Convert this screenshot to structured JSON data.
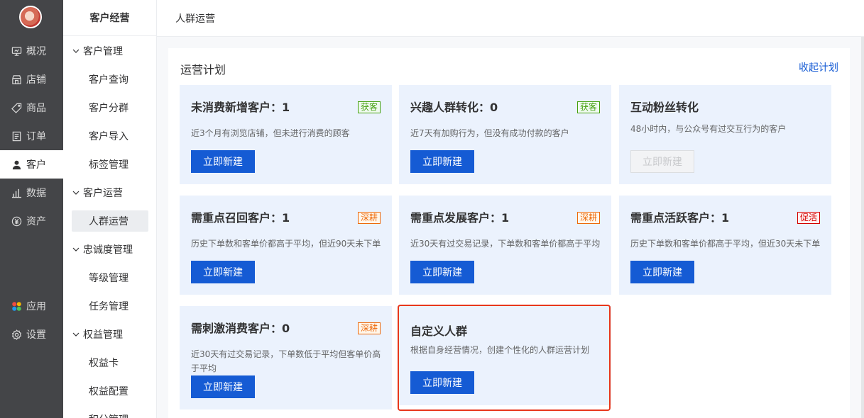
{
  "primary_nav": {
    "items": [
      {
        "label": "概况",
        "icon": "overview-icon"
      },
      {
        "label": "店铺",
        "icon": "store-icon"
      },
      {
        "label": "商品",
        "icon": "tag-icon"
      },
      {
        "label": "订单",
        "icon": "order-icon"
      },
      {
        "label": "客户",
        "icon": "user-icon",
        "active": true
      },
      {
        "label": "数据",
        "icon": "chart-icon"
      },
      {
        "label": "资产",
        "icon": "yen-icon"
      }
    ],
    "bottom_items": [
      {
        "label": "应用",
        "icon": "apps-icon"
      },
      {
        "label": "设置",
        "icon": "gear-icon"
      }
    ]
  },
  "secondary_nav": {
    "title": "客户经营",
    "groups": [
      {
        "label": "客户管理",
        "items": [
          "客户查询",
          "客户分群",
          "客户导入",
          "标签管理"
        ]
      },
      {
        "label": "客户运营",
        "items": [
          "人群运营"
        ]
      },
      {
        "label": "忠诚度管理",
        "items": [
          "等级管理",
          "任务管理"
        ]
      },
      {
        "label": "权益管理",
        "items": [
          "权益卡",
          "权益配置",
          "积分管理"
        ]
      }
    ],
    "active_item": "人群运营"
  },
  "header": {
    "breadcrumb": "人群运营"
  },
  "main": {
    "section_title": "运营计划",
    "collapse_label": "收起计划",
    "cards": [
      {
        "title": "未消费新增客户：1",
        "desc": "近3个月有浏览店铺，但未进行消费的顾客",
        "tag": "获客",
        "tag_color": "#45a110",
        "button": "立即新建"
      },
      {
        "title": "兴趣人群转化：0",
        "desc": "近7天有加购行为，但没有成功付款的客户",
        "tag": "获客",
        "tag_color": "#45a110",
        "button": "立即新建"
      },
      {
        "title": "互动粉丝转化",
        "desc": "48小时内，与公众号有过交互行为的客户",
        "tag": "",
        "button": "立即新建",
        "disabled": true
      },
      {
        "title": "需重点召回客户：1",
        "desc": "历史下单数和客单价都高于平均，但近90天未下单",
        "tag": "深耕",
        "tag_color": "#ed6a0c",
        "button": "立即新建"
      },
      {
        "title": "需重点发展客户：1",
        "desc": "近30天有过交易记录，下单数和客单价都高于平均",
        "tag": "深耕",
        "tag_color": "#ed6a0c",
        "button": "立即新建"
      },
      {
        "title": "需重点活跃客户：1",
        "desc": "历史下单数和客单价都高于平均，但近30天未下单",
        "tag": "促活",
        "tag_color": "#d40000",
        "button": "立即新建"
      },
      {
        "title": "需刺激消费客户：0",
        "desc": "近30天有过交易记录，下单数低于平均但客单价高于平均",
        "tag": "深耕",
        "tag_color": "#ed6a0c",
        "button": "立即新建"
      },
      {
        "title": "自定义人群",
        "desc": "根据自身经营情况，创建个性化的人群运营计划",
        "tag": "",
        "button": "立即新建",
        "highlighted": true
      }
    ]
  },
  "colors": {
    "accent": "#155bd4",
    "card_bg": "#ebf2fd",
    "highlight": "#e8371c"
  }
}
